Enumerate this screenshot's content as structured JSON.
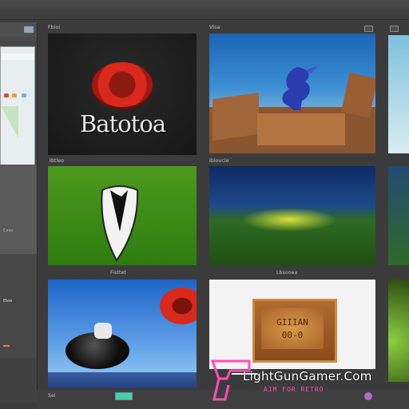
{
  "grid": {
    "tiles": [
      {
        "label": "Fbloi",
        "logo_text": "Batotoa"
      },
      {
        "label": "Vlsa"
      },
      {
        "label": ""
      },
      {
        "label": "Ibtleo"
      },
      {
        "label": "Iblovcle"
      },
      {
        "label": ""
      },
      {
        "label": "Fisttet"
      },
      {
        "label": "Lbsooea",
        "box_text_1": "GIIIAN",
        "box_text_2": "00-0"
      },
      {
        "label": ""
      }
    ],
    "bottom_left_label": "Sel"
  },
  "left_panel": {
    "label_1": "Cxvs",
    "label_2": "Etoe"
  },
  "watermark": {
    "main": "LightGunGamer.Com",
    "sub": "AIM FOR RETRO"
  },
  "colors": {
    "background": "#3b3b3b",
    "accent_red": "#d9281c",
    "watermark_pink": "#ff4fb3"
  }
}
